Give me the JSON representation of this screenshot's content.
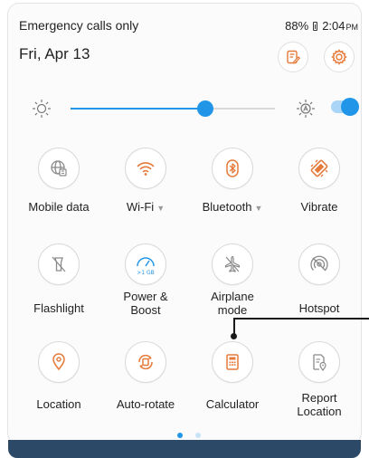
{
  "status": {
    "carrier": "Emergency calls only",
    "battery": "88%",
    "time": "2:04",
    "ampm": "PM"
  },
  "header": {
    "date": "Fri, Apr 13",
    "edit_icon": "edit-note-icon",
    "settings_icon": "gear-icon"
  },
  "brightness": {
    "level_percent": 66,
    "auto_enabled": true
  },
  "tiles": [
    {
      "label": "Mobile data",
      "icon": "mobile-data-icon"
    },
    {
      "label": "Wi-Fi",
      "icon": "wifi-icon",
      "expandable": true
    },
    {
      "label": "Bluetooth",
      "icon": "bluetooth-icon",
      "expandable": true
    },
    {
      "label": "Vibrate",
      "icon": "vibrate-icon"
    },
    {
      "label": "Flashlight",
      "icon": "flashlight-icon"
    },
    {
      "label": "Power & Boost",
      "line1": "Power &",
      "line2": "Boost",
      "icon": "power-boost-icon",
      "badge": ">1 GB"
    },
    {
      "label": "Airplane mode",
      "line1": "Airplane",
      "line2": "mode",
      "icon": "airplane-icon"
    },
    {
      "label": "Hotspot",
      "icon": "hotspot-icon"
    },
    {
      "label": "Location",
      "icon": "location-pin-icon"
    },
    {
      "label": "Auto-rotate",
      "icon": "auto-rotate-icon"
    },
    {
      "label": "Calculator",
      "icon": "calculator-icon"
    },
    {
      "label": "Report Location",
      "line1": "Report",
      "line2": "Location",
      "icon": "report-location-icon"
    }
  ],
  "page_indicator": {
    "pages": 2,
    "current": 1
  },
  "colors": {
    "accent": "#2196e8",
    "nav_bar": "#2c4a68"
  }
}
